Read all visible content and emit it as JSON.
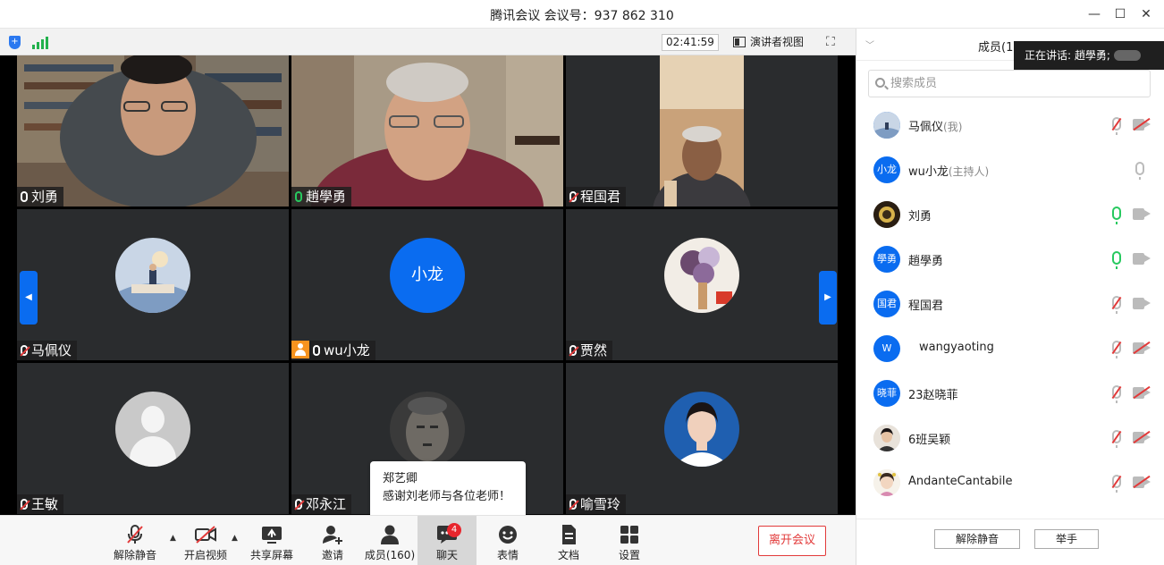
{
  "window": {
    "title": "腾讯会议 会议号：937 862 310"
  },
  "topbar": {
    "timer": "02:41:59",
    "view_label": "演讲者视图"
  },
  "tiles": [
    {
      "name": "刘勇",
      "mic": "on"
    },
    {
      "name": "趙學勇",
      "mic": "live"
    },
    {
      "name": "程国君",
      "mic": "muted"
    },
    {
      "name": "马佩仪",
      "mic": "muted"
    },
    {
      "name": "wu小龙",
      "mic": "on",
      "avatar_text": "小龙"
    },
    {
      "name": "贾然",
      "mic": "muted"
    },
    {
      "name": "王敏",
      "mic": "muted"
    },
    {
      "name": "邓永江",
      "mic": "muted"
    },
    {
      "name": "喻雪玲",
      "mic": "muted"
    }
  ],
  "chat_popup": {
    "sender": "郑艺卿",
    "message": "感谢刘老师与各位老师！"
  },
  "toolbar": {
    "mute": "解除静音",
    "video": "开启视频",
    "share": "共享屏幕",
    "invite": "邀请",
    "members": "成员(160)",
    "chat": "聊天",
    "chat_badge": "4",
    "reactions": "表情",
    "docs": "文档",
    "settings": "设置",
    "leave": "离开会议"
  },
  "panel": {
    "title": "成员(16",
    "speaking": "正在讲话: 趙學勇;",
    "search_placeholder": "搜索成员",
    "members": [
      {
        "name": "马佩仪",
        "tag": "(我)",
        "avatar": "",
        "mic": "muted",
        "cam": "off"
      },
      {
        "name": "wu小龙",
        "tag": "(主持人)",
        "avatar": "小龙",
        "mic": "on",
        "cam": "none"
      },
      {
        "name": "刘勇",
        "tag": "",
        "avatar": "",
        "mic": "green",
        "cam": "on"
      },
      {
        "name": "趙學勇",
        "tag": "",
        "avatar": "學勇",
        "mic": "green",
        "cam": "on"
      },
      {
        "name": "程国君",
        "tag": "",
        "avatar": "国君",
        "mic": "muted",
        "cam": "on"
      },
      {
        "name": "wangyaoting",
        "tag": "",
        "avatar": "W",
        "mic": "muted",
        "cam": "off"
      },
      {
        "name": "23赵晓菲",
        "tag": "",
        "avatar": "晓菲",
        "mic": "muted",
        "cam": "off"
      },
      {
        "name": "6班吴颖",
        "tag": "",
        "avatar": "",
        "mic": "muted",
        "cam": "off"
      },
      {
        "name": "AndanteCantabile",
        "tag": "",
        "avatar": "",
        "mic": "muted",
        "cam": "off"
      }
    ],
    "unmute_all": "解除静音",
    "raise_hand": "举手"
  }
}
